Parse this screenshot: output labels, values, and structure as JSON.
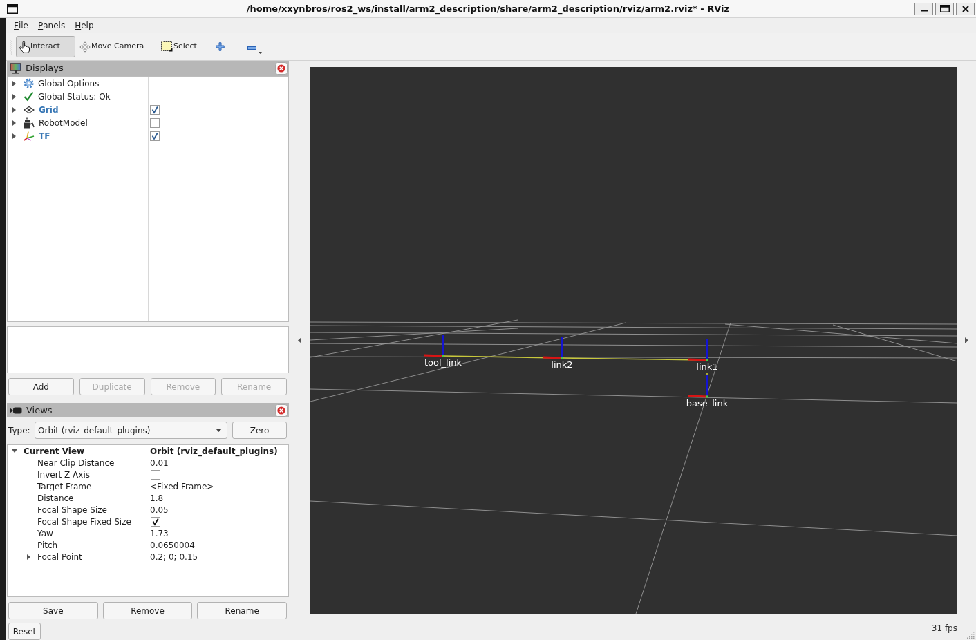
{
  "window": {
    "title": "/home/xxynbros/ros2_ws/install/arm2_description/share/arm2_description/rviz/arm2.rviz* - RViz"
  },
  "menu": [
    "File",
    "Panels",
    "Help"
  ],
  "toolbar": {
    "tools": [
      {
        "kind": "interact",
        "label": "Interact",
        "selected": true
      },
      {
        "kind": "move_camera",
        "label": "Move Camera",
        "selected": false
      },
      {
        "kind": "select",
        "label": "Select",
        "selected": false
      },
      {
        "kind": "add",
        "selected": false
      },
      {
        "kind": "remove",
        "selected": false
      }
    ]
  },
  "displays": {
    "title": "Displays",
    "items": [
      {
        "kind": "options",
        "label": "Global Options",
        "expanded": false
      },
      {
        "kind": "status",
        "label": "Global Status: Ok",
        "expanded": false
      },
      {
        "kind": "grid",
        "label": "Grid",
        "expanded": false,
        "checked": true
      },
      {
        "kind": "robot_model",
        "label": "RobotModel",
        "expanded": false,
        "checked": false
      },
      {
        "kind": "tf",
        "label": "TF",
        "expanded": false,
        "checked": true
      }
    ],
    "buttons": [
      {
        "label": "Add",
        "disabled": false
      },
      {
        "label": "Duplicate",
        "disabled": true
      },
      {
        "label": "Remove",
        "disabled": true
      },
      {
        "label": "Rename",
        "disabled": true
      }
    ]
  },
  "views": {
    "title": "Views",
    "type_label": "Type:",
    "type_value": "Orbit (rviz_default_plugins)",
    "zero_button": "Zero",
    "properties": [
      {
        "kind": "text",
        "label": "Current View",
        "value": "Orbit (rviz_default_plugins)",
        "expanded": true,
        "children": [
          {
            "kind": "text",
            "label": "Near Clip Distance",
            "value": "0.01"
          },
          {
            "kind": "checkbox",
            "label": "Invert Z Axis",
            "checked": false
          },
          {
            "kind": "text",
            "label": "Target Frame",
            "value": "<Fixed Frame>"
          },
          {
            "kind": "text",
            "label": "Distance",
            "value": "1.8"
          },
          {
            "kind": "text",
            "label": "Focal Shape Size",
            "value": "0.05"
          },
          {
            "kind": "checkbox",
            "label": "Focal Shape Fixed Size",
            "checked": true
          },
          {
            "kind": "text",
            "label": "Yaw",
            "value": "1.73"
          },
          {
            "kind": "text",
            "label": "Pitch",
            "value": "0.0650004"
          },
          {
            "kind": "text",
            "label": "Focal Point",
            "value": "0.2; 0; 0.15",
            "expanded": false
          }
        ]
      }
    ],
    "buttons": [
      "Save",
      "Remove",
      "Rename",
      "Reset"
    ]
  },
  "viewport": {
    "frames": [
      {
        "label": "tool_link"
      },
      {
        "label": "link2"
      },
      {
        "label": "link1"
      },
      {
        "label": "base_link"
      }
    ]
  },
  "status_bar": {
    "fps": "31 fps"
  }
}
